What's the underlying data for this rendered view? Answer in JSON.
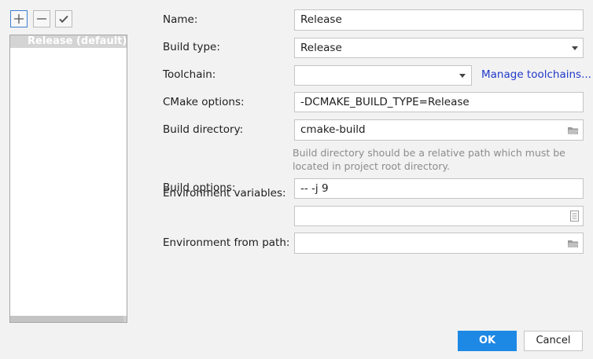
{
  "profiles": {
    "items": [
      {
        "label": "Release (default)"
      }
    ]
  },
  "form": {
    "name_label": "Name:",
    "name_value": "Release",
    "build_type_label": "Build type:",
    "build_type_value": "Release",
    "toolchain_label": "Toolchain:",
    "toolchain_value": "",
    "manage_toolchains_link": "Manage toolchains...",
    "cmake_options_label": "CMake options:",
    "cmake_options_value": "-DCMAKE_BUILD_TYPE=Release",
    "build_directory_label": "Build directory:",
    "build_directory_value": "cmake-build",
    "build_directory_hint": "Build directory should be a relative path which must be located in project root directory.",
    "build_options_label": "Build options:",
    "build_options_value": "-- -j 9",
    "env_vars_label": "Environment variables:",
    "env_vars_value": "",
    "env_from_path_label": "Environment from path:",
    "env_from_path_value": ""
  },
  "dialog": {
    "ok_label": "OK",
    "cancel_label": "Cancel"
  }
}
